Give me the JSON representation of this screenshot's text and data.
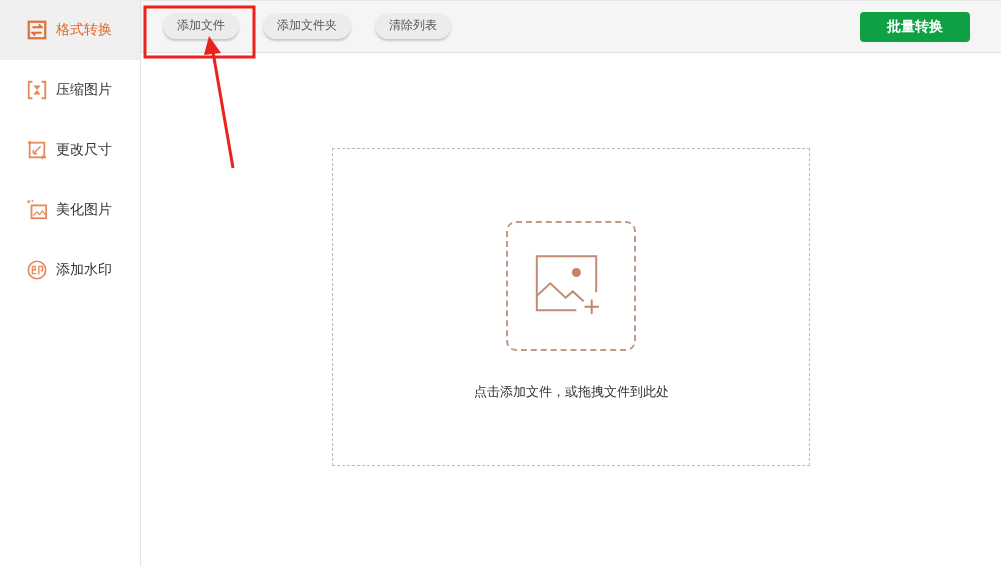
{
  "sidebar": {
    "items": [
      {
        "label": "格式转换",
        "selected": true
      },
      {
        "label": "压缩图片",
        "selected": false
      },
      {
        "label": "更改尺寸",
        "selected": false
      },
      {
        "label": "美化图片",
        "selected": false
      },
      {
        "label": "添加水印",
        "selected": false
      }
    ]
  },
  "toolbar": {
    "buttons": [
      "添加文件",
      "添加文件夹",
      "清除列表"
    ],
    "primary_button": "批量转换"
  },
  "drop_zone": {
    "hint": "点击添加文件，或拖拽文件到此处"
  }
}
